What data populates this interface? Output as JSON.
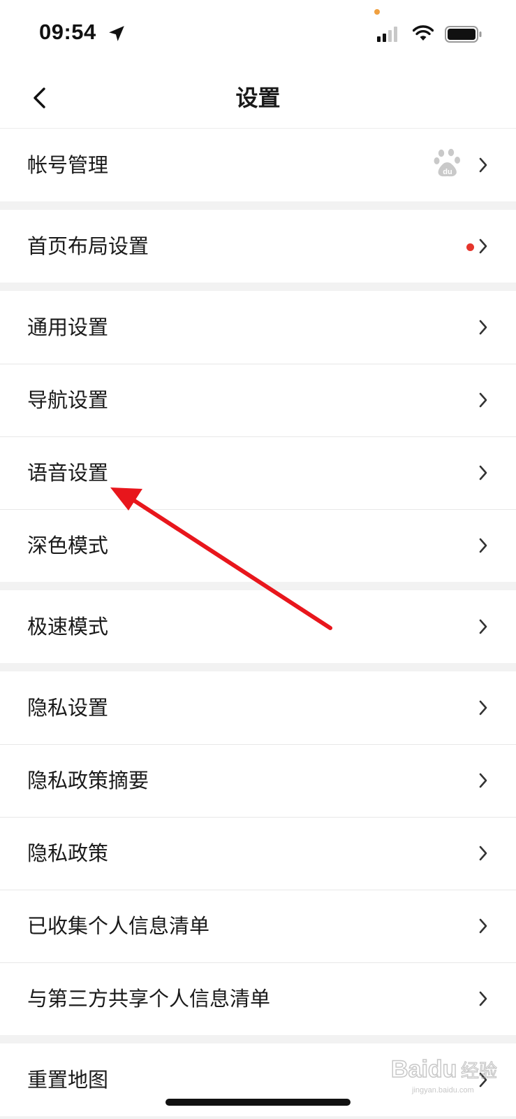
{
  "status_bar": {
    "time": "09:54"
  },
  "header": {
    "title": "设置"
  },
  "groups": [
    {
      "items": [
        {
          "label": "帐号管理",
          "accessory": "baidu-paw-icon"
        }
      ]
    },
    {
      "items": [
        {
          "label": "首页布局设置",
          "accessory": "red-dot"
        }
      ]
    },
    {
      "items": [
        {
          "label": "通用设置"
        },
        {
          "label": "导航设置"
        },
        {
          "label": "语音设置"
        },
        {
          "label": "深色模式"
        }
      ]
    },
    {
      "items": [
        {
          "label": "极速模式"
        }
      ]
    },
    {
      "items": [
        {
          "label": "隐私设置"
        },
        {
          "label": "隐私政策摘要"
        },
        {
          "label": "隐私政策"
        },
        {
          "label": "已收集个人信息清单"
        },
        {
          "label": "与第三方共享个人信息清单"
        }
      ]
    },
    {
      "items": [
        {
          "label": "重置地图"
        }
      ]
    }
  ],
  "colors": {
    "background": "#f2f2f2",
    "row": "#ffffff",
    "annotation_arrow": "#e8161c",
    "red_dot": "#e5352c"
  },
  "watermark": {
    "brand": "Baidu 经验",
    "site": "jingyan.baidu.com"
  }
}
